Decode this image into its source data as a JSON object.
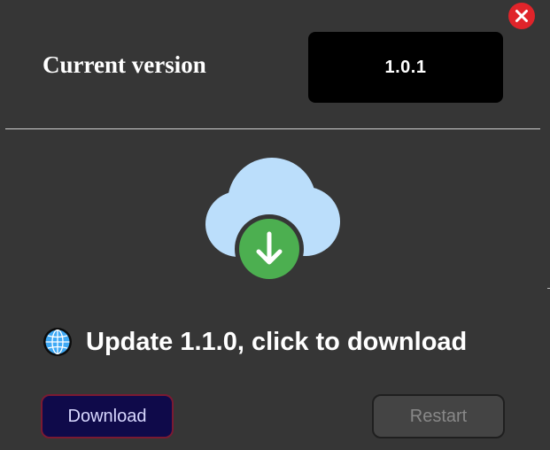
{
  "current_version": {
    "label": "Current version",
    "value": "1.0.1"
  },
  "update": {
    "message": "Update 1.1.0, click to download",
    "icon": "globe-icon",
    "illustration": "cloud-download-icon"
  },
  "buttons": {
    "download_label": "Download",
    "restart_label": "Restart"
  },
  "window": {
    "close_icon": "close-icon"
  },
  "colors": {
    "background": "#363636",
    "close_red": "#e0242a",
    "cloud_blue": "#bbdefb",
    "download_green": "#4caf50",
    "download_button_bg": "#0f0a4a",
    "download_button_border": "#7a1a32"
  }
}
